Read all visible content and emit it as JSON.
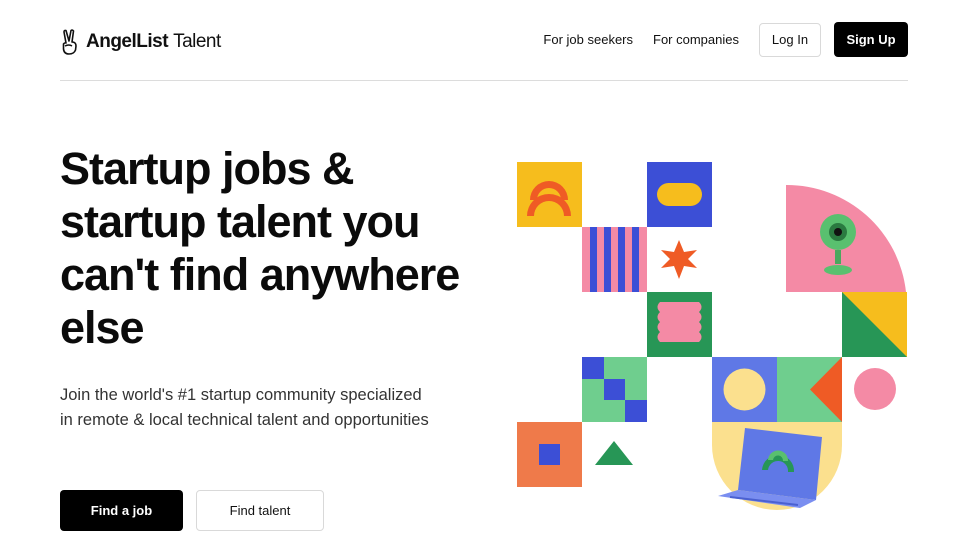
{
  "header": {
    "brand": "AngelList",
    "brand_sub": "Talent",
    "nav": [
      "For job seekers",
      "For companies"
    ],
    "login_label": "Log In",
    "signup_label": "Sign Up"
  },
  "hero": {
    "title": "Startup jobs & startup talent you can't find anywhere else",
    "subtitle": "Join the world's #1 startup community specialized in remote & local technical talent and opportunities",
    "find_job_label": "Find a job",
    "find_talent_label": "Find talent"
  },
  "colors": {
    "yellow": "#f6bd1d",
    "blue": "#3c4fd6",
    "pink": "#f48aa5",
    "orange": "#ef5b25",
    "green": "#279656",
    "mint": "#6fce8e",
    "cream": "#fbe08e",
    "periwinkle": "#5f78e6",
    "terracotta": "#ef7a4a"
  },
  "icons": {
    "logo": "peace-hand-icon"
  }
}
